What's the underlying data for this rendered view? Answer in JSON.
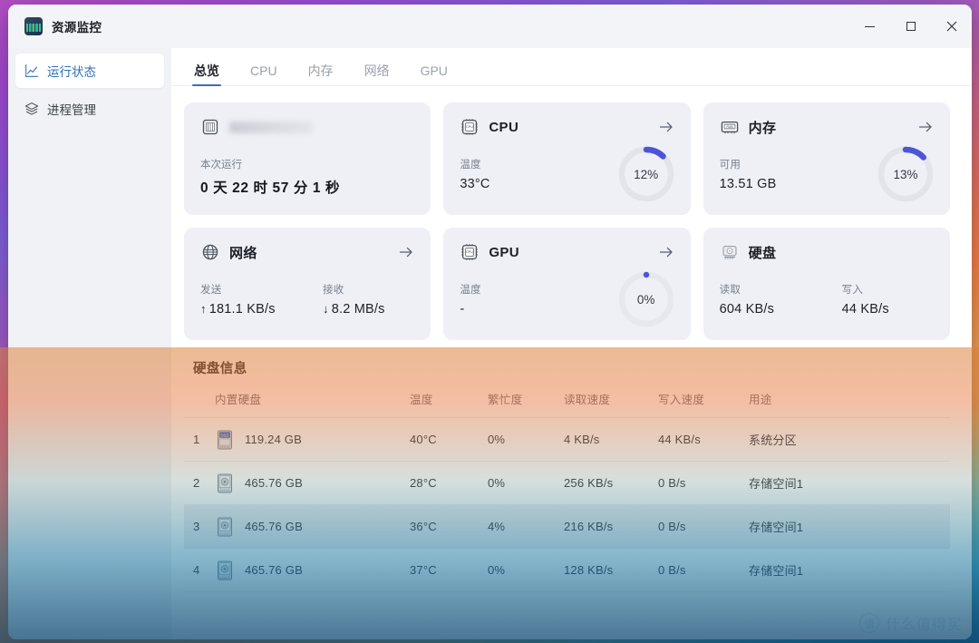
{
  "window": {
    "app_title": "资源监控",
    "app_icon": "chart-app-icon",
    "controls": {
      "minimize": "minimize-icon",
      "maximize": "maximize-icon",
      "close": "close-icon"
    }
  },
  "sidebar": {
    "items": [
      {
        "label": "运行状态",
        "icon": "line-chart-icon",
        "active": true
      },
      {
        "label": "进程管理",
        "icon": "layers-icon",
        "active": false
      }
    ]
  },
  "tabs": [
    {
      "label": "总览",
      "active": true
    },
    {
      "label": "CPU",
      "active": false
    },
    {
      "label": "内存",
      "active": false
    },
    {
      "label": "网络",
      "active": false
    },
    {
      "label": "GPU",
      "active": false
    }
  ],
  "colors": {
    "accent": "#3a6fb5",
    "gauge_arc": "#4b55d6",
    "gauge_track": "#e2e4ea",
    "card_bg": "#eef0f5",
    "sidebar_bg": "#f0f2f6",
    "titlebar_bg": "#f3f4f7",
    "row_highlight": "#eceef1"
  },
  "cards": {
    "uptime": {
      "icon": "cpu-chip-icon",
      "title_blurred": true,
      "title": "",
      "label": "本次运行",
      "value": "0 天 22 时 57 分 1 秒"
    },
    "cpu": {
      "icon": "cpu-chip-icon",
      "title": "CPU",
      "arrow": "arrow-right-icon",
      "label": "温度",
      "value": "33°C",
      "gauge": {
        "percent_label": "12%",
        "percent": 12
      }
    },
    "memory": {
      "icon": "ram-icon",
      "title": "内存",
      "arrow": "arrow-right-icon",
      "label": "可用",
      "value": "13.51 GB",
      "gauge": {
        "percent_label": "13%",
        "percent": 13
      }
    },
    "network": {
      "icon": "globe-icon",
      "title": "网络",
      "arrow": "arrow-right-icon",
      "send_label": "发送",
      "send_value": "181.1 KB/s",
      "send_dir": "↑",
      "recv_label": "接收",
      "recv_value": "8.2 MB/s",
      "recv_dir": "↓"
    },
    "gpu": {
      "icon": "gpu-chip-icon",
      "title": "GPU",
      "arrow": "arrow-right-icon",
      "label": "温度",
      "value": "-",
      "gauge": {
        "percent_label": "0%",
        "percent": 0
      }
    },
    "disk": {
      "icon": "hard-disk-icon",
      "title": "硬盘",
      "read_label": "读取",
      "read_value": "604 KB/s",
      "write_label": "写入",
      "write_value": "44 KB/s"
    }
  },
  "disk_section": {
    "title": "硬盘信息",
    "columns": [
      "内置硬盘",
      "温度",
      "繁忙度",
      "读取速度",
      "写入速度",
      "用途"
    ],
    "rows": [
      {
        "index": "1",
        "icon": "ssd-icon",
        "capacity": "119.24 GB",
        "temperature": "40°C",
        "busy": "0%",
        "read": "4 KB/s",
        "write": "44 KB/s",
        "usage": "系统分区",
        "highlighted": false
      },
      {
        "index": "2",
        "icon": "hdd-icon",
        "capacity": "465.76 GB",
        "temperature": "28°C",
        "busy": "0%",
        "read": "256 KB/s",
        "write": "0 B/s",
        "usage": "存储空间1",
        "highlighted": false
      },
      {
        "index": "3",
        "icon": "hdd-icon",
        "capacity": "465.76 GB",
        "temperature": "36°C",
        "busy": "4%",
        "read": "216 KB/s",
        "write": "0 B/s",
        "usage": "存储空间1",
        "highlighted": true
      },
      {
        "index": "4",
        "icon": "hdd-icon",
        "capacity": "465.76 GB",
        "temperature": "37°C",
        "busy": "0%",
        "read": "128 KB/s",
        "write": "0 B/s",
        "usage": "存储空间1",
        "highlighted": false
      }
    ]
  },
  "watermark": {
    "mark": "值",
    "text": "什么值得买"
  }
}
